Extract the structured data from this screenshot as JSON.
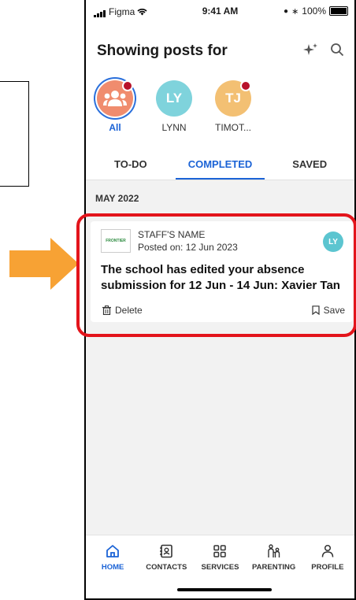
{
  "status": {
    "carrier": "Figma",
    "time": "9:41 AM",
    "battery": "100%"
  },
  "header": {
    "title": "Showing posts for"
  },
  "avatars": [
    {
      "initials": "",
      "label": "All",
      "active": true
    },
    {
      "initials": "LY",
      "label": "LYNN",
      "active": false
    },
    {
      "initials": "TJ",
      "label": "TIMOT...",
      "active": false
    }
  ],
  "tabs": [
    {
      "label": "TO-DO"
    },
    {
      "label": "COMPLETED"
    },
    {
      "label": "SAVED"
    }
  ],
  "section": {
    "label": "MAY 2022"
  },
  "card": {
    "logo_text": "FRONTIER",
    "staff_name": "STAFF'S NAME",
    "posted": "Posted on: 12 Jun 2023",
    "avatar_initials": "LY",
    "title": "The school has edited your absence submission for 12 Jun - 14 Jun: Xavier Tan",
    "delete_label": "Delete",
    "save_label": "Save"
  },
  "nav": [
    {
      "label": "HOME",
      "icon": "home-icon"
    },
    {
      "label": "CONTACTS",
      "icon": "contacts-icon"
    },
    {
      "label": "SERVICES",
      "icon": "services-icon"
    },
    {
      "label": "PARENTING",
      "icon": "parenting-icon"
    },
    {
      "label": "PROFILE",
      "icon": "profile-icon"
    }
  ],
  "colors": {
    "accent": "#1b63d6",
    "highlight": "#e3141b",
    "arrow": "#f7a234",
    "avatar_all": "#f08c6e",
    "avatar_ly": "#7fd3dc",
    "avatar_tj": "#f3c073"
  }
}
